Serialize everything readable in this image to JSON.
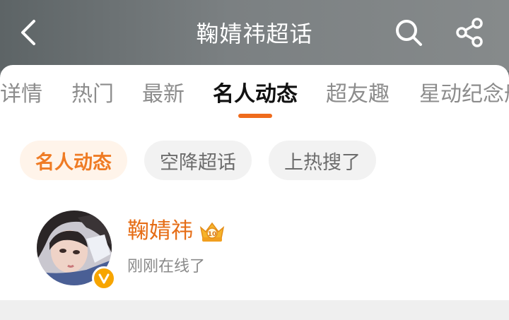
{
  "header": {
    "title": "鞠婧祎超话"
  },
  "tabs": [
    {
      "label": "详情"
    },
    {
      "label": "热门"
    },
    {
      "label": "最新"
    },
    {
      "label": "名人动态"
    },
    {
      "label": "超友趣"
    },
    {
      "label": "星动纪念册"
    }
  ],
  "chips": [
    {
      "label": "名人动态"
    },
    {
      "label": "空降超话"
    },
    {
      "label": "上热搜了"
    }
  ],
  "user": {
    "name": "鞠婧祎",
    "status": "刚刚在线了",
    "level_badge": "10"
  },
  "colors": {
    "accent": "#ef6b1c",
    "name": "#e66d16",
    "chip_active_bg": "#fff4ea",
    "chip_bg": "#f2f2f2"
  },
  "icons": [
    "back-icon",
    "search-icon",
    "share-icon",
    "verified-v-icon",
    "crown-level-icon"
  ]
}
